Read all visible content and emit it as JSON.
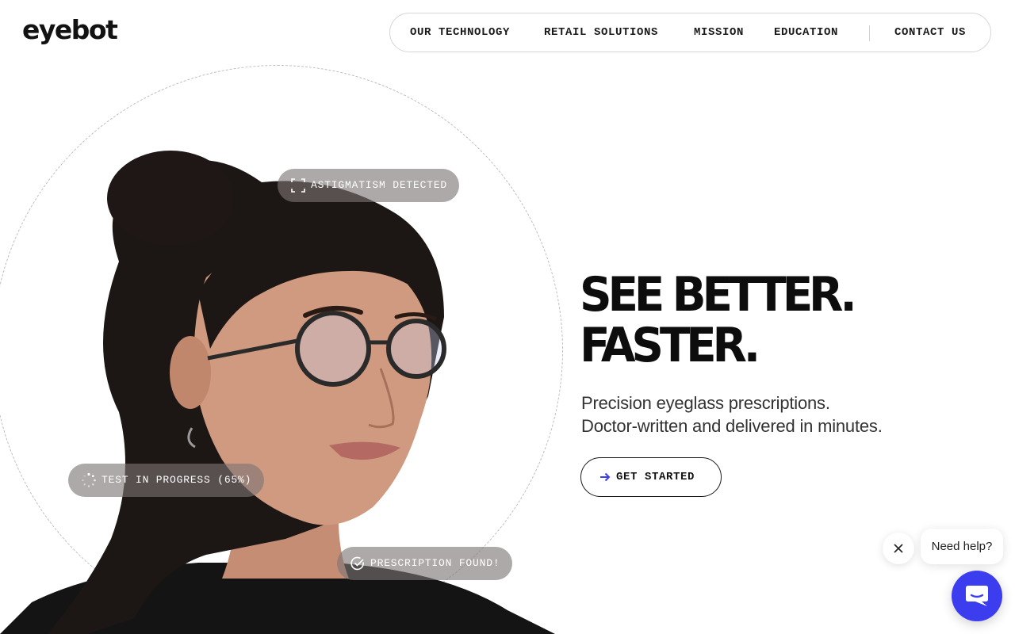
{
  "brand": {
    "logo_text": "eyebot",
    "accent_color": "#3d3df0"
  },
  "nav": {
    "items": [
      {
        "label": "OUR TECHNOLOGY"
      },
      {
        "label": "RETAIL SOLUTIONS"
      },
      {
        "label": "MISSION"
      },
      {
        "label": "EDUCATION"
      }
    ],
    "contact_label": "CONTACT US"
  },
  "hero": {
    "image": {
      "icon": "portrait-woman-with-glasses"
    },
    "badges": [
      {
        "label": "ASTIGMATISM DETECTED",
        "icon": "scan-frame-icon"
      },
      {
        "label": "TEST IN PROGRESS (65%)",
        "icon": "spinner-icon"
      },
      {
        "label": "PRESCRIPTION FOUND!",
        "icon": "check-circle-icon"
      }
    ],
    "headline_line1": "SEE BETTER.",
    "headline_line2": "FASTER.",
    "subhead_line1": "Precision eyeglass prescriptions.",
    "subhead_line2": "Doctor-written and delivered in minutes.",
    "cta_label": "GET STARTED",
    "cta_icon": "arrow-right-icon"
  },
  "chat": {
    "bubble_text": "Need help?",
    "close_icon": "close-icon",
    "launcher_icon": "chat-icon",
    "launcher_color": "#3d3df0"
  }
}
